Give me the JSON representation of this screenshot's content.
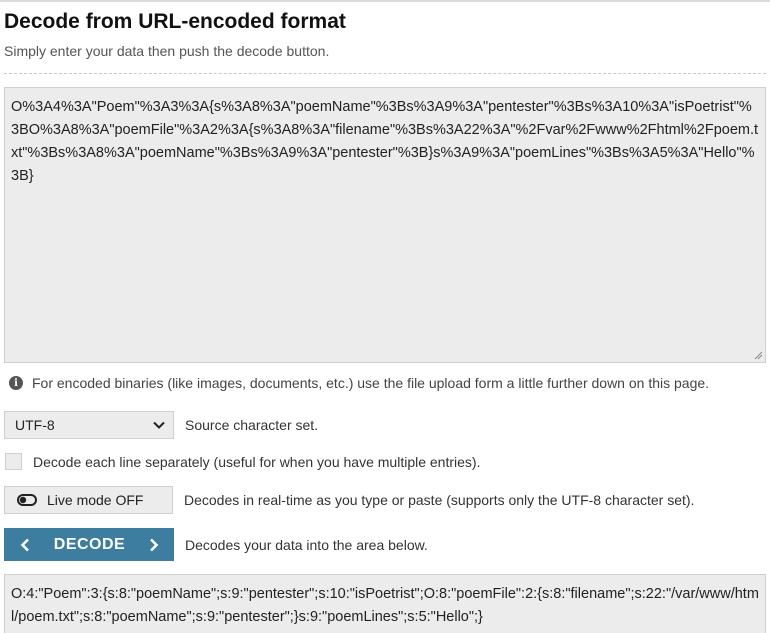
{
  "header": {
    "title": "Decode from URL-encoded format",
    "subtitle": "Simply enter your data then push the decode button."
  },
  "input": {
    "value": "O%3A4%3A\"Poem\"%3A3%3A{s%3A8%3A\"poemName\"%3Bs%3A9%3A\"pentester\"%3Bs%3A10%3A\"isPoetrist\"%3BO%3A8%3A\"poemFile\"%3A2%3A{s%3A8%3A\"filename\"%3Bs%3A22%3A\"%2Fvar%2Fwww%2Fhtml%2Fpoem.txt\"%3Bs%3A8%3A\"poemName\"%3Bs%3A9%3A\"pentester\"%3B}s%3A9%3A\"poemLines\"%3Bs%3A5%3A\"Hello\"%3B}"
  },
  "info": {
    "icon": "info-icon",
    "text": "For encoded binaries (like images, documents, etc.) use the file upload form a little further down on this page."
  },
  "charset": {
    "selected": "UTF-8",
    "label": "Source character set."
  },
  "each_line": {
    "checked": false,
    "label": "Decode each line separately (useful for when you have multiple entries)."
  },
  "live_mode": {
    "button_label": "Live mode OFF",
    "description": "Decodes in real-time as you type or paste (supports only the UTF-8 character set)."
  },
  "decode": {
    "button_label": "DECODE",
    "description": "Decodes your data into the area below."
  },
  "output": {
    "value": "O:4:\"Poem\":3:{s:8:\"poemName\";s:9:\"pentester\";s:10:\"isPoetrist\";O:8:\"poemFile\":2:{s:8:\"filename\";s:22:\"/var/www/html/poem.txt\";s:8:\"poemName\";s:9:\"pentester\";}s:9:\"poemLines\";s:5:\"Hello\";}"
  },
  "colors": {
    "accent": "#3c7da0",
    "field_bg": "#ececec"
  }
}
